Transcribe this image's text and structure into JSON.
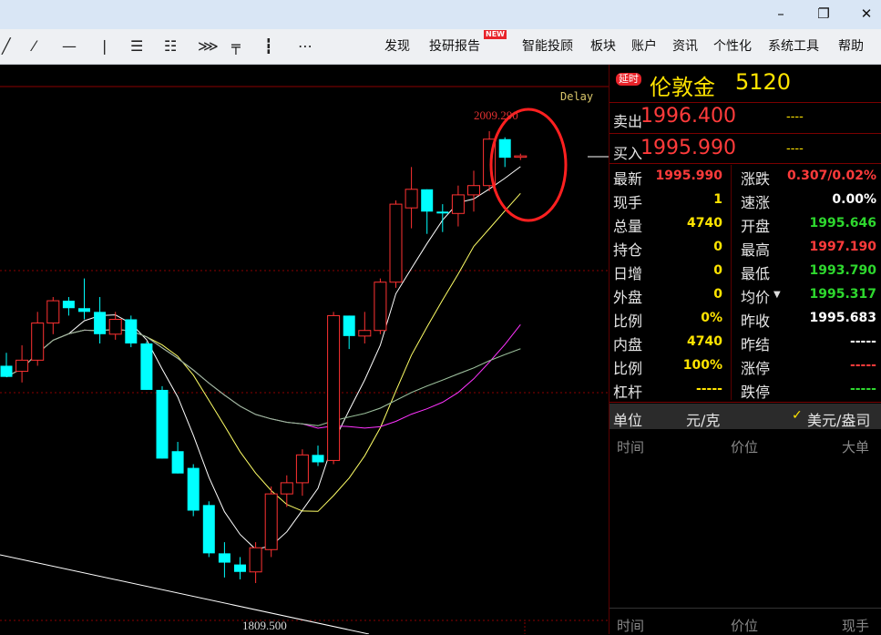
{
  "window": {
    "minimize": "–",
    "restore": "❐",
    "close": "✕"
  },
  "toolbar": {
    "tools": [
      "draw-line-icon",
      "draw-ray-icon",
      "horizontal-line-icon",
      "vertical-line-icon",
      "parallel-lines-icon",
      "channel-icon",
      "fan-lines-icon",
      "fibonacci-icon",
      "period-lines-icon",
      "more-tools-icon"
    ],
    "tool_glyphs": [
      "╱",
      "⁄",
      "—",
      "❘",
      "☰",
      "☷",
      "⋙",
      "╤",
      "┇",
      "⋯"
    ],
    "menu": [
      "发现",
      "投研报告",
      "智能投顾",
      "板块",
      "账户",
      "资讯",
      "个性化",
      "系统工具",
      "帮助"
    ],
    "new_badge": "NEW"
  },
  "chart": {
    "delay_label": "Delay",
    "high_label": "2009.290",
    "low_label": "1809.500"
  },
  "chart_data": {
    "type": "candlestick",
    "high_marker": 2009.29,
    "low_marker": 1809.5,
    "candles": [
      {
        "o": 1883,
        "h": 1890,
        "l": 1877,
        "c": 1877,
        "up": false
      },
      {
        "o": 1880,
        "h": 1894,
        "l": 1874,
        "c": 1886,
        "up": true
      },
      {
        "o": 1886,
        "h": 1912,
        "l": 1883,
        "c": 1906,
        "up": true
      },
      {
        "o": 1906,
        "h": 1920,
        "l": 1900,
        "c": 1918,
        "up": true
      },
      {
        "o": 1918,
        "h": 1920,
        "l": 1910,
        "c": 1914,
        "up": false
      },
      {
        "o": 1914,
        "h": 1930,
        "l": 1908,
        "c": 1912,
        "up": false
      },
      {
        "o": 1912,
        "h": 1920,
        "l": 1895,
        "c": 1900,
        "up": false
      },
      {
        "o": 1900,
        "h": 1912,
        "l": 1897,
        "c": 1908,
        "up": true
      },
      {
        "o": 1908,
        "h": 1910,
        "l": 1893,
        "c": 1895,
        "up": false
      },
      {
        "o": 1895,
        "h": 1896,
        "l": 1870,
        "c": 1870,
        "up": false
      },
      {
        "o": 1870,
        "h": 1872,
        "l": 1833,
        "c": 1833,
        "up": false
      },
      {
        "o": 1837,
        "h": 1842,
        "l": 1825,
        "c": 1825,
        "up": false
      },
      {
        "o": 1828,
        "h": 1830,
        "l": 1802,
        "c": 1805,
        "up": false
      },
      {
        "o": 1808,
        "h": 1810,
        "l": 1780,
        "c": 1782,
        "up": false
      },
      {
        "o": 1782,
        "h": 1788,
        "l": 1769,
        "c": 1777,
        "up": false
      },
      {
        "o": 1776,
        "h": 1780,
        "l": 1768,
        "c": 1772,
        "up": false
      },
      {
        "o": 1772,
        "h": 1788,
        "l": 1766,
        "c": 1785,
        "up": true
      },
      {
        "o": 1784,
        "h": 1818,
        "l": 1780,
        "c": 1814,
        "up": true
      },
      {
        "o": 1814,
        "h": 1824,
        "l": 1807,
        "c": 1820,
        "up": true
      },
      {
        "o": 1820,
        "h": 1838,
        "l": 1813,
        "c": 1835,
        "up": true
      },
      {
        "o": 1835,
        "h": 1840,
        "l": 1829,
        "c": 1831,
        "up": false
      },
      {
        "o": 1832,
        "h": 1912,
        "l": 1830,
        "c": 1910,
        "up": true
      },
      {
        "o": 1910,
        "h": 1910,
        "l": 1892,
        "c": 1899,
        "up": false
      },
      {
        "o": 1899,
        "h": 1912,
        "l": 1895,
        "c": 1902,
        "up": true
      },
      {
        "o": 1902,
        "h": 1930,
        "l": 1900,
        "c": 1928,
        "up": true
      },
      {
        "o": 1928,
        "h": 1972,
        "l": 1925,
        "c": 1970,
        "up": true
      },
      {
        "o": 1968,
        "h": 1990,
        "l": 1957,
        "c": 1978,
        "up": true
      },
      {
        "o": 1978,
        "h": 1978,
        "l": 1954,
        "c": 1966,
        "up": false
      },
      {
        "o": 1966,
        "h": 1970,
        "l": 1955,
        "c": 1965,
        "up": false
      },
      {
        "o": 1965,
        "h": 1980,
        "l": 1958,
        "c": 1975,
        "up": true
      },
      {
        "o": 1975,
        "h": 1988,
        "l": 1966,
        "c": 1980,
        "up": true
      },
      {
        "o": 1980,
        "h": 2009.29,
        "l": 1977,
        "c": 2005,
        "up": true
      },
      {
        "o": 2005,
        "h": 2006,
        "l": 1990,
        "c": 1995,
        "up": false
      },
      {
        "o": 1995.646,
        "h": 1997.19,
        "l": 1993.79,
        "c": 1995.99,
        "up": true
      }
    ]
  },
  "quote": {
    "delay_badge": "延时",
    "name": "伦敦金",
    "code": "5120",
    "sell_label": "卖出",
    "sell_value": "1996.400",
    "sell_extra": "----",
    "buy_label": "买入",
    "buy_value": "1995.990",
    "buy_extra": "----",
    "rows": [
      {
        "l1": "最新",
        "v1": "1995.990",
        "c1": "#ff3b3b",
        "l2": "涨跌",
        "v2": "0.307/0.02%",
        "c2": "#ff3b3b"
      },
      {
        "l1": "现手",
        "v1": "1",
        "c1": "#ffe400",
        "l2": "速涨",
        "v2": "0.00%",
        "c2": "#ffffff"
      },
      {
        "l1": "总量",
        "v1": "4740",
        "c1": "#ffe400",
        "l2": "开盘",
        "v2": "1995.646",
        "c2": "#2ed82e"
      },
      {
        "l1": "持仓",
        "v1": "0",
        "c1": "#ffe400",
        "l2": "最高",
        "v2": "1997.190",
        "c2": "#ff3b3b"
      },
      {
        "l1": "日增",
        "v1": "0",
        "c1": "#ffe400",
        "l2": "最低",
        "v2": "1993.790",
        "c2": "#2ed82e"
      },
      {
        "l1": "外盘",
        "v1": "0",
        "c1": "#ffe400",
        "l2": "均价",
        "v2": "1995.317",
        "c2": "#2ed82e"
      },
      {
        "l1": "比例",
        "v1": "0%",
        "c1": "#ffe400",
        "l2": "昨收",
        "v2": "1995.683",
        "c2": "#ffffff"
      },
      {
        "l1": "内盘",
        "v1": "4740",
        "c1": "#ffe400",
        "l2": "昨结",
        "v2": "-----",
        "c2": "#ffffff"
      },
      {
        "l1": "比例",
        "v1": "100%",
        "c1": "#ffe400",
        "l2": "涨停",
        "v2": "-----",
        "c2": "#ff3b3b"
      },
      {
        "l1": "杠杆",
        "v1": "-----",
        "c1": "#ffe400",
        "l2": "跌停",
        "v2": "-----",
        "c2": "#2ed82e"
      }
    ],
    "unit_label": "单位",
    "unit_value": "元/克",
    "unit_option": "美元/盎司",
    "ticks_header": {
      "time": "时间",
      "price": "价位",
      "big": "大单"
    },
    "trades_header": {
      "time": "时间",
      "price": "价位",
      "hand": "现手"
    }
  },
  "colors": {
    "up": "#ff3232",
    "down": "#00ffff",
    "ma5": "#ffffff",
    "ma10": "#ffff66",
    "ma20": "#ff33ff",
    "ma40": "#00ff00",
    "ma60": "#aaaaaa",
    "grid": "#8b0000",
    "highlight": "#ff2020"
  }
}
